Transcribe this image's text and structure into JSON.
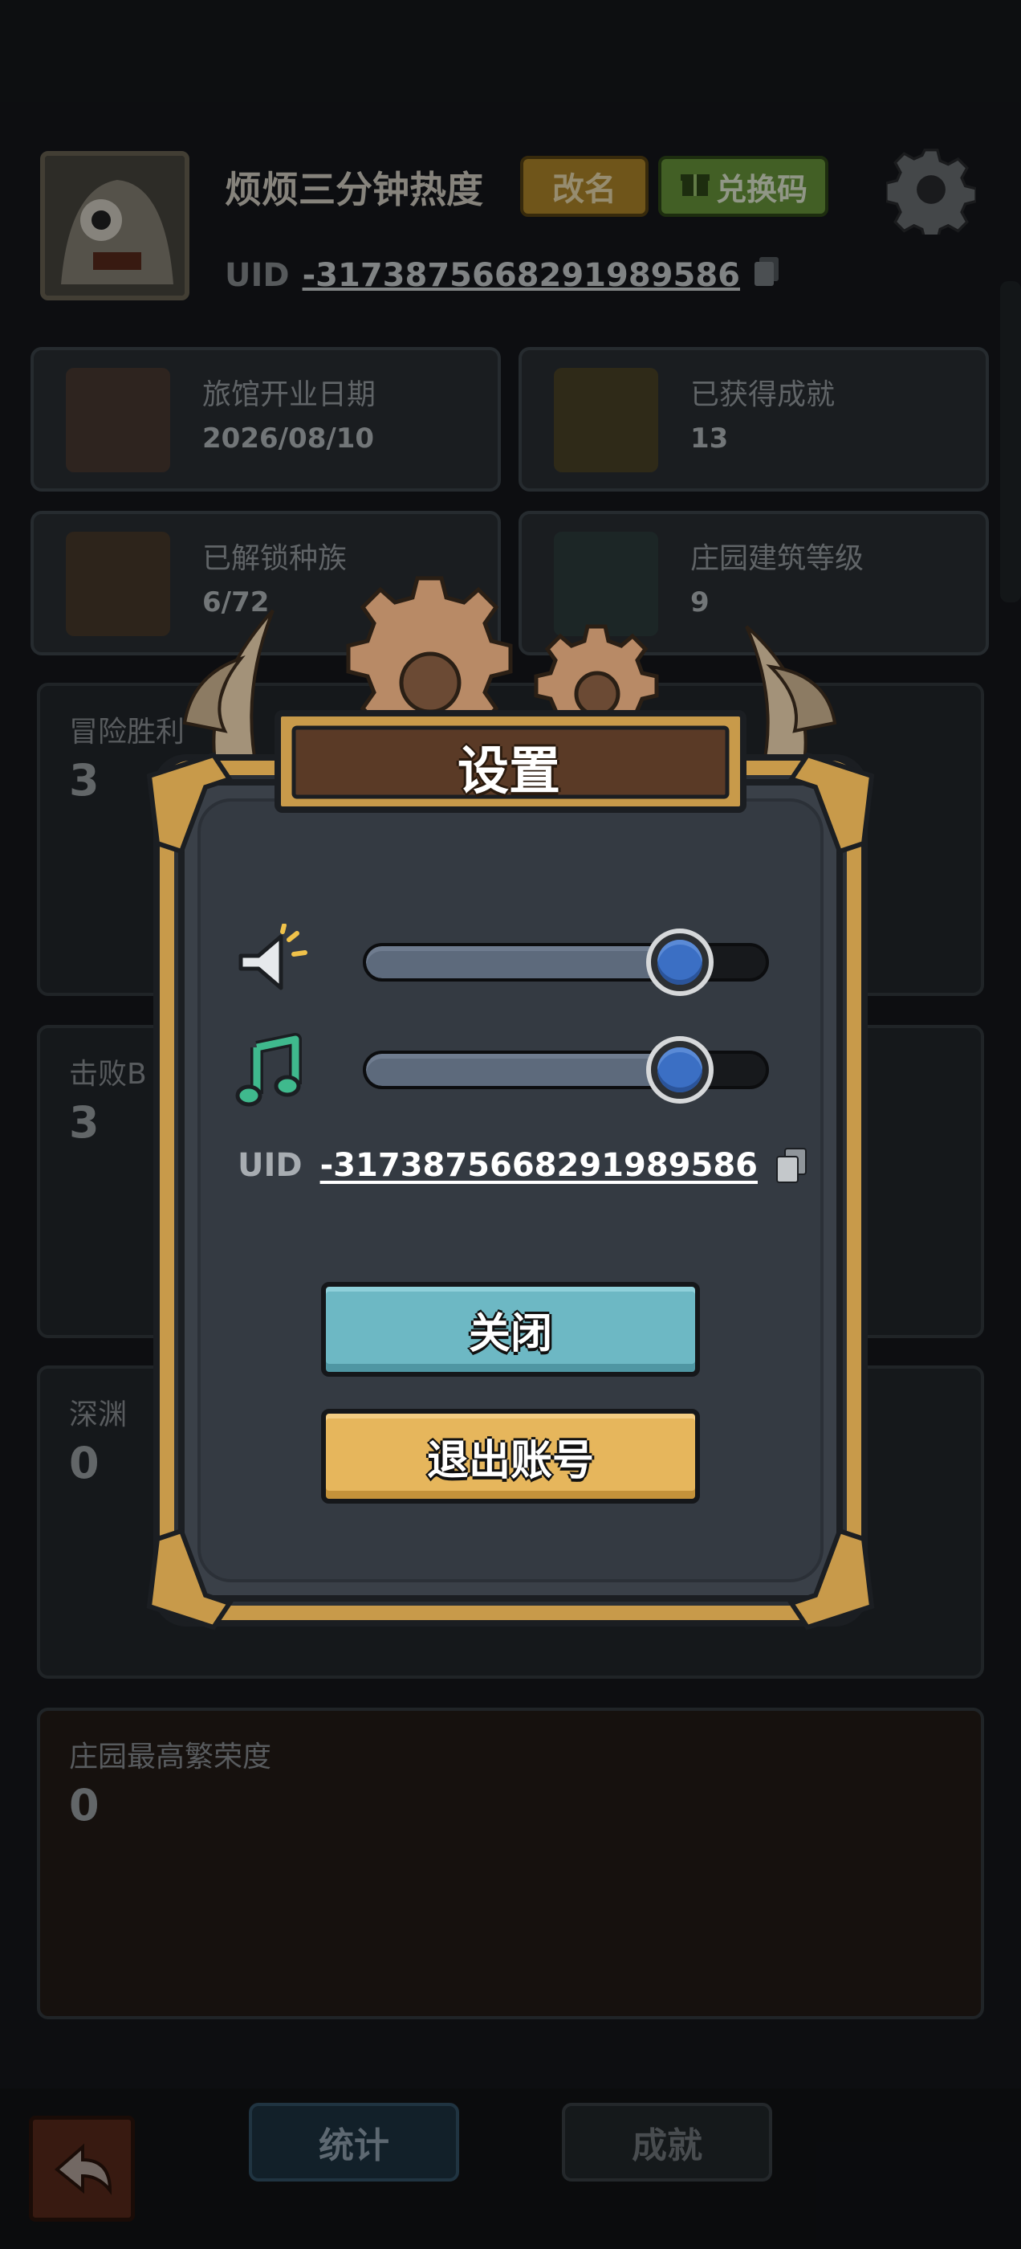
{
  "profile": {
    "nickname": "烦烦三分钟热度",
    "rename_label": "改名",
    "redeem_label": "兑换码",
    "uid_label": "UID",
    "uid_value": "-3173875668291989586"
  },
  "stats": [
    {
      "label": "旅馆开业日期",
      "value": "2026/08/10"
    },
    {
      "label": "已获得成就",
      "value": "13"
    },
    {
      "label": "已解锁种族",
      "value": "6/72"
    },
    {
      "label": "庄园建筑等级",
      "value": "9"
    }
  ],
  "records": [
    {
      "label": "冒险胜利",
      "value": "3"
    },
    {
      "label": "击败B",
      "value": "3"
    },
    {
      "label": "深渊",
      "value": "0"
    },
    {
      "label": "庄园最高繁荣度",
      "value": "0"
    }
  ],
  "tabs": {
    "stats": "统计",
    "achievements": "成就"
  },
  "dialog": {
    "title": "设置",
    "sound_volume": 0.78,
    "music_volume": 0.78,
    "uid_label": "UID",
    "uid_value": "-3173875668291989586",
    "close_label": "关闭",
    "logout_label": "退出账号"
  },
  "colors": {
    "close_button": "#6db8c4",
    "logout_button": "#e6b65c",
    "slider_thumb": "#3b6fc4",
    "frame_gold": "#c89a4a"
  },
  "icons": {
    "sound": "speaker-icon",
    "music": "music-note-icon",
    "copy": "copy-icon",
    "settings": "gear-icon",
    "back": "back-arrow-icon"
  }
}
